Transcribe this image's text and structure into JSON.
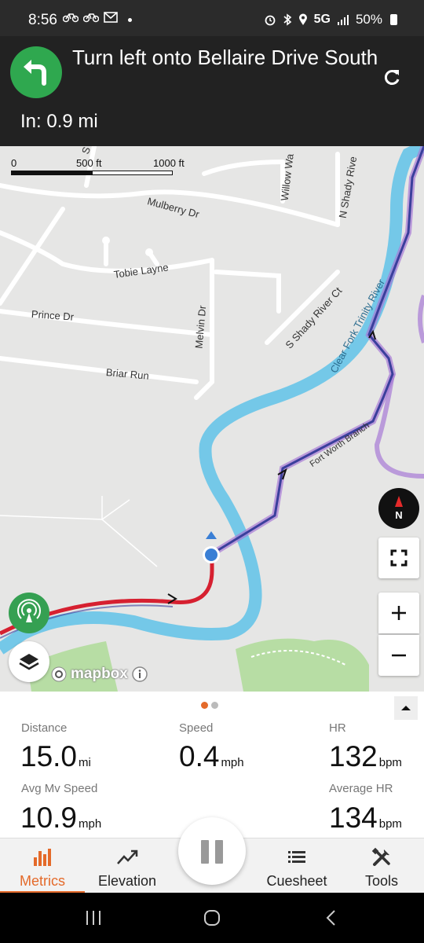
{
  "status_bar": {
    "time": "8:56",
    "left_icons": [
      "cycling-icon",
      "cycling-icon",
      "mail-icon",
      "dot-icon"
    ],
    "network": "5G",
    "battery": "50%",
    "right_icons": [
      "alarm-icon",
      "bluetooth-icon",
      "location-icon",
      "signal-icon",
      "battery-icon"
    ]
  },
  "navigation": {
    "instruction": "Turn left onto Bellaire Drive South",
    "distance": "In: 0.9 mi",
    "turn_icon": "turn-left-arrow-icon",
    "accent_color": "#2fa84f"
  },
  "map": {
    "scale": {
      "labels": [
        "0",
        "500 ft",
        "1000 ft"
      ]
    },
    "street_labels": {
      "s_top": "S T",
      "willow": "Willow Wa",
      "n_shady": "N Shady Rive",
      "mulberry": "Mulberry Dr",
      "tobie": "Tobie Layne",
      "prince": "Prince Dr",
      "melvin": "Melvin Dr",
      "s_shady": "S Shady River Ct",
      "briar": "Briar Run",
      "river": "Clear Fork Trinity River",
      "fort_worth": "Fort Worth Branch"
    },
    "compass_label": "N",
    "attribution": "mapbox",
    "route_color": "#3b3f9c",
    "track_color": "#d62030",
    "water_color": "#74c8e8"
  },
  "metrics": {
    "page_dots": 2,
    "active_page": 1,
    "items": [
      {
        "label": "Distance",
        "value": "15.0",
        "unit": "mi"
      },
      {
        "label": "Speed",
        "value": "0.4",
        "unit": "mph"
      },
      {
        "label": "HR",
        "value": "132",
        "unit": "bpm"
      },
      {
        "label": "Avg Mv Speed",
        "value": "10.9",
        "unit": "mph"
      },
      {
        "label": "Average HR",
        "value": "134",
        "unit": "bpm"
      }
    ]
  },
  "tabs": [
    {
      "label": "Metrics",
      "icon": "bar-chart-icon",
      "active": true
    },
    {
      "label": "Elevation",
      "icon": "trend-line-icon",
      "active": false
    },
    {
      "label": "Cuesheet",
      "icon": "list-icon",
      "active": false
    },
    {
      "label": "Tools",
      "icon": "tools-icon",
      "active": false
    }
  ],
  "accent": "#e46a2a"
}
